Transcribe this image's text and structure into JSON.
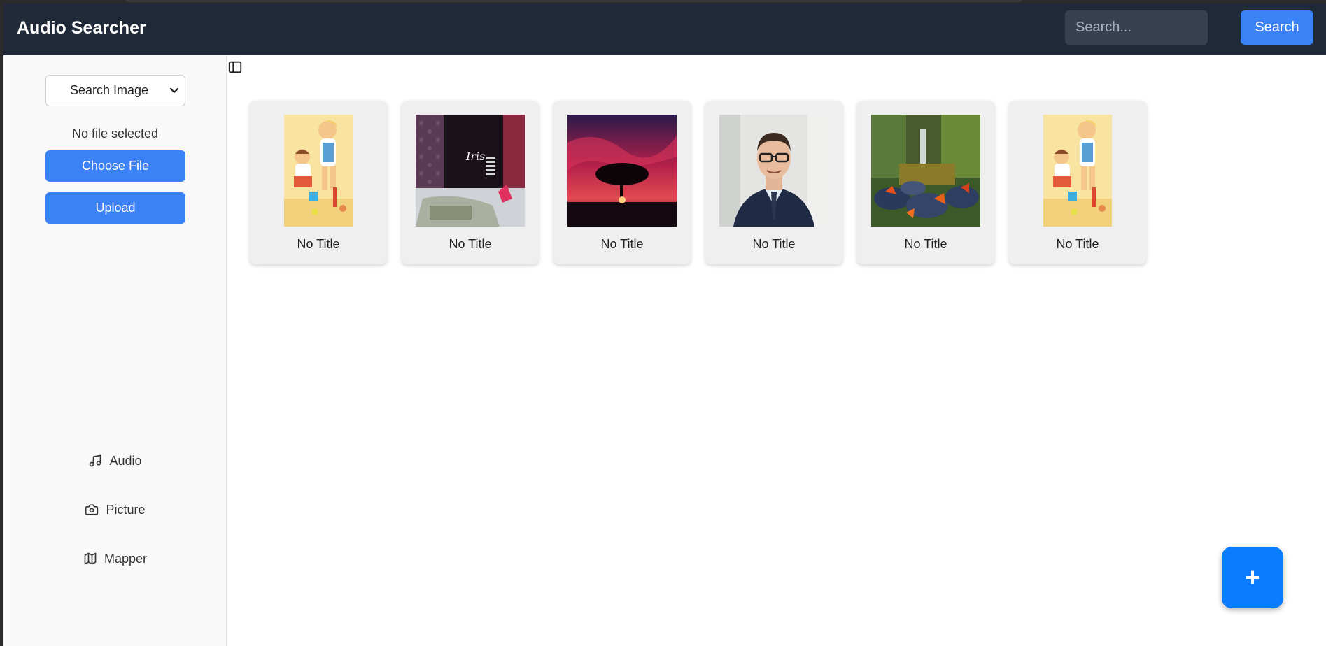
{
  "header": {
    "title": "Audio Searcher",
    "search_placeholder": "Search...",
    "search_button": "Search"
  },
  "sidebar": {
    "select_value": "Search Image",
    "file_status": "No file selected",
    "choose_file_label": "Choose File",
    "upload_label": "Upload",
    "nav": [
      {
        "label": "Audio",
        "icon": "music-note-icon"
      },
      {
        "label": "Picture",
        "icon": "camera-icon"
      },
      {
        "label": "Mapper",
        "icon": "map-icon"
      }
    ]
  },
  "gallery": {
    "cards": [
      {
        "caption": "No Title",
        "image": "cartoon-children-illustration"
      },
      {
        "caption": "No Title",
        "image": "iris-album-cover"
      },
      {
        "caption": "No Title",
        "image": "red-sky-tree-sunset"
      },
      {
        "caption": "No Title",
        "image": "man-in-suit-portrait"
      },
      {
        "caption": "No Title",
        "image": "waterfall-autumn-leaves"
      },
      {
        "caption": "No Title",
        "image": "cartoon-children-illustration"
      }
    ],
    "iris_text": "Iris"
  },
  "fab": {
    "label": "+"
  },
  "colors": {
    "header_bg": "#1f2937",
    "accent": "#3b82f6",
    "fab": "#0a7cff",
    "card_bg": "#efefef"
  }
}
